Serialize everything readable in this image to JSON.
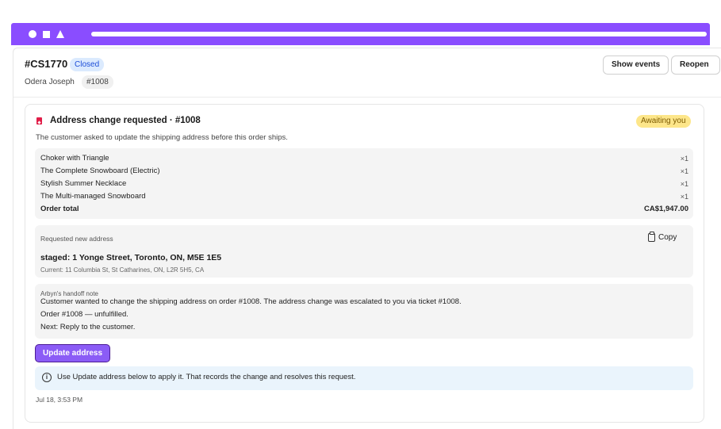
{
  "ticket": {
    "id": "#CS1770",
    "status": "Closed",
    "customer": "Odera Joseph",
    "order_ref": "#1008",
    "actions": {
      "show_events": "Show events",
      "reopen": "Reopen"
    }
  },
  "card": {
    "title": "Address change requested · #1008",
    "badge": "Awaiting you",
    "description": "The customer asked to update the shipping address before this order ships.",
    "items": [
      {
        "name": "Choker with Triangle",
        "qty": "×1"
      },
      {
        "name": "The Complete Snowboard (Electric)",
        "qty": "×1"
      },
      {
        "name": "Stylish Summer Necklace",
        "qty": "×1"
      },
      {
        "name": "The Multi-managed Snowboard",
        "qty": "×1"
      }
    ],
    "total_label": "Order total",
    "total_value": "CA$1,947.00",
    "address": {
      "label": "Requested new address",
      "copy_label": "Copy",
      "new": "staged: 1 Yonge Street, Toronto, ON, M5E 1E5",
      "current": "Current: 11 Columbia St, St Catharines, ON, L2R 5H5, CA"
    },
    "note": {
      "label": "Arbyn's handoff note",
      "lines": [
        "Customer wanted to change the shipping address on order #1008. The address change was escalated to you via ticket #1008.",
        "Order #1008 — unfulfilled.",
        "Next: Reply to the customer."
      ]
    },
    "primary_button": "Update address",
    "info_icon": "i",
    "info_text": "Use Update address below to apply it. That records the change and resolves this request.",
    "timestamp": "Jul 18, 3:53 PM"
  },
  "colors": {
    "accent": "#8a4dff",
    "button": "#8b5cf6",
    "status_bg": "#dbeafe",
    "badge_bg": "#fde68a",
    "info_bg": "#eaf4fc"
  },
  "icons": {
    "card": "tag-icon",
    "copy": "clipboard-icon",
    "info": "info-icon"
  }
}
